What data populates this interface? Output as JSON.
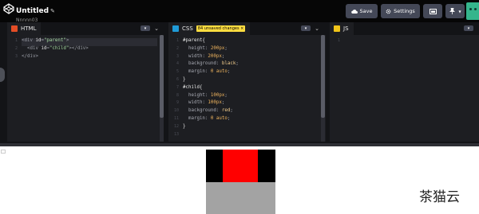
{
  "header": {
    "title": "Untitled",
    "username": "Nnnnn03",
    "buttons": {
      "save": "Save",
      "settings": "Settings"
    }
  },
  "colors": {
    "topbar": "#060606",
    "button": "#444857",
    "editor_bg": "#1d1e22",
    "unsaved_badge": "#ffdd40",
    "html_icon": "#e44d26",
    "css_icon": "#1f9ad6",
    "js_icon": "#f0c419",
    "preview_parent": "#000000",
    "preview_child": "#ff0000"
  },
  "icons": {
    "logo": "codepen-logo-icon",
    "pencil": "pencil-icon",
    "save": "cloud-icon",
    "settings": "gear-icon",
    "layout": "layout-icon",
    "pin": "pin-icon"
  },
  "editors": {
    "html": {
      "label": "HTML",
      "line_numbers": [
        "1",
        "2",
        "3"
      ],
      "lines": [
        [
          {
            "t": "<div ",
            "c": "t-tag"
          },
          {
            "t": "id",
            "c": "t-attr"
          },
          {
            "t": "=",
            "c": "t-tag"
          },
          {
            "t": "\"parent\"",
            "c": "t-str"
          },
          {
            "t": ">",
            "c": "t-tag"
          }
        ],
        [
          {
            "t": "  <div ",
            "c": "t-tag"
          },
          {
            "t": "id",
            "c": "t-attr"
          },
          {
            "t": "=",
            "c": "t-tag"
          },
          {
            "t": "\"child\"",
            "c": "t-str"
          },
          {
            "t": "></div>",
            "c": "t-tag"
          }
        ],
        [
          {
            "t": "</div>",
            "c": "t-tag"
          }
        ]
      ]
    },
    "css": {
      "label": "CSS",
      "unsaved": "84 unsaved changes",
      "line_numbers": [
        "1",
        "2",
        "3",
        "4",
        "5",
        "6",
        "7",
        "8",
        "9",
        "10",
        "11",
        "12",
        "13"
      ],
      "lines": [
        [
          {
            "t": "#parent{",
            "c": "t-sel"
          }
        ],
        [
          {
            "t": "  height",
            "c": "t-prop"
          },
          {
            "t": ": ",
            "c": "t-prop"
          },
          {
            "t": "200px",
            "c": "t-num"
          },
          {
            "t": ";",
            "c": "t-prop"
          }
        ],
        [
          {
            "t": "  width",
            "c": "t-prop"
          },
          {
            "t": ": ",
            "c": "t-prop"
          },
          {
            "t": "200px",
            "c": "t-num"
          },
          {
            "t": ";",
            "c": "t-prop"
          }
        ],
        [
          {
            "t": "  background",
            "c": "t-prop"
          },
          {
            "t": ": ",
            "c": "t-prop"
          },
          {
            "t": "black",
            "c": "t-val"
          },
          {
            "t": ";",
            "c": "t-prop"
          }
        ],
        [
          {
            "t": "  margin",
            "c": "t-prop"
          },
          {
            "t": ": ",
            "c": "t-prop"
          },
          {
            "t": "0 auto",
            "c": "t-num"
          },
          {
            "t": ";",
            "c": "t-prop"
          }
        ],
        [
          {
            "t": "}",
            "c": "t-sel"
          }
        ],
        [
          {
            "t": "#child{",
            "c": "t-sel"
          }
        ],
        [
          {
            "t": "  height",
            "c": "t-prop"
          },
          {
            "t": ": ",
            "c": "t-prop"
          },
          {
            "t": "100px",
            "c": "t-num"
          },
          {
            "t": ";",
            "c": "t-prop"
          }
        ],
        [
          {
            "t": "  width",
            "c": "t-prop"
          },
          {
            "t": ": ",
            "c": "t-prop"
          },
          {
            "t": "100px",
            "c": "t-num"
          },
          {
            "t": ";",
            "c": "t-prop"
          }
        ],
        [
          {
            "t": "  background",
            "c": "t-prop"
          },
          {
            "t": ": ",
            "c": "t-prop"
          },
          {
            "t": "red",
            "c": "t-val"
          },
          {
            "t": ";",
            "c": "t-prop"
          }
        ],
        [
          {
            "t": "  margin",
            "c": "t-prop"
          },
          {
            "t": ": ",
            "c": "t-prop"
          },
          {
            "t": "0 auto",
            "c": "t-num"
          },
          {
            "t": ";",
            "c": "t-prop"
          }
        ],
        [
          {
            "t": "}",
            "c": "t-sel"
          }
        ],
        []
      ]
    },
    "js": {
      "label": "JS",
      "line_numbers": [
        "1"
      ],
      "lines": [
        []
      ]
    }
  },
  "watermark": "茶猫云"
}
